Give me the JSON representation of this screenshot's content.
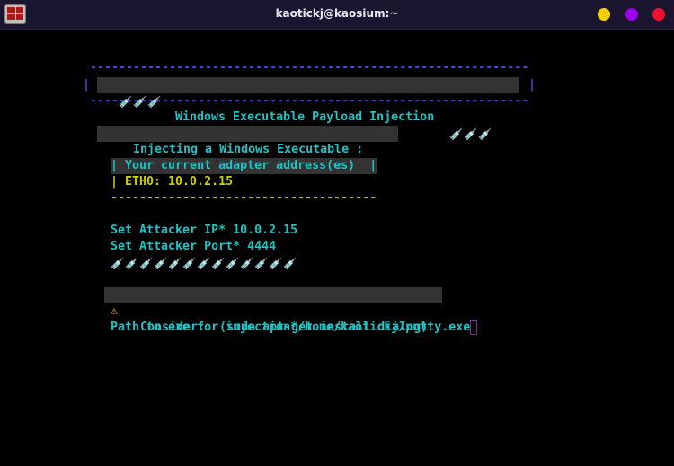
{
  "window": {
    "title": "kaotickj@kaosium:~",
    "buttons": [
      {
        "name": "minimize",
        "color": "#f5d000"
      },
      {
        "name": "maximize",
        "color": "#9a00f0"
      },
      {
        "name": "close",
        "color": "#f01030"
      }
    ]
  },
  "terminal": {
    "banner_border": "-------------------------------------------------------------",
    "banner_pipe": "|",
    "banner_title": "Windows Executable Payload Injection",
    "banner_syringes": 3,
    "section_heading": "Injecting a Windows Executable :",
    "adapter_header": "| Your current adapter address(es)  |",
    "adapter_line": "| ETH0: 10.0.2.15",
    "adapter_divider": "-------------------------------------",
    "attacker_ip": "Set Attacker IP* 10.0.2.15",
    "attacker_port": "Set Attacker Port* 4444",
    "syringe_row_count": 13,
    "warning_icon": "⚠",
    "consider": "Consider:  (sudo apt-get install dialog)",
    "prompt": "Path to exe for injection*/home/kaotickj/putty.exe",
    "syringe_icon": "syringe-icon"
  }
}
